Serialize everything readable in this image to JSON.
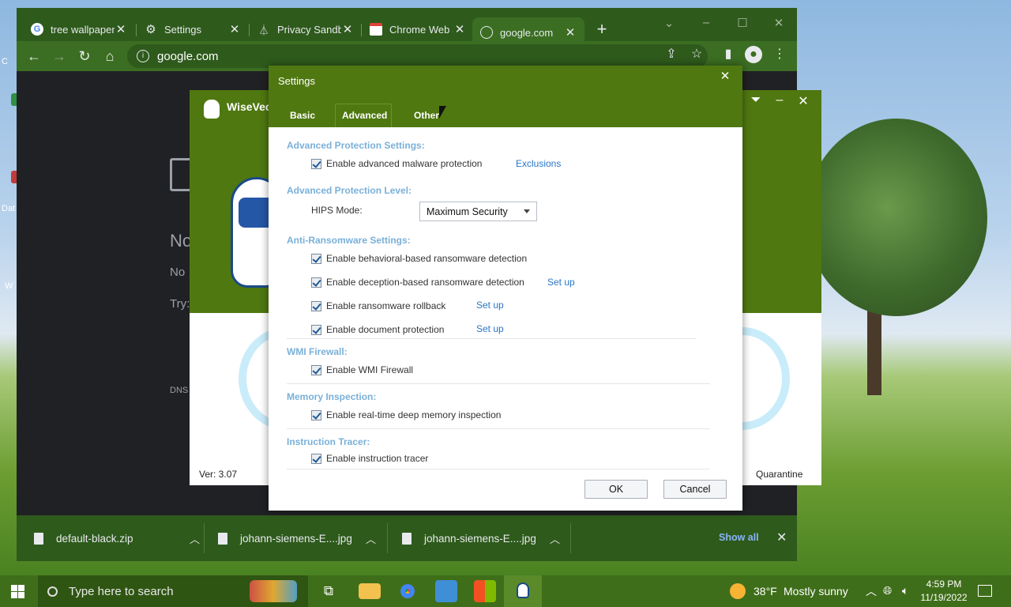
{
  "desktop": {
    "icon_labels": [
      "C",
      "C",
      "Dat",
      "W"
    ]
  },
  "chrome": {
    "tabs": [
      {
        "label": "tree wallpaper",
        "icon": "google-icon"
      },
      {
        "label": "Settings",
        "icon": "gear-icon"
      },
      {
        "label": "Privacy Sandbox",
        "icon": "flask-icon"
      },
      {
        "label": "Chrome Web Store",
        "icon": "store-icon"
      },
      {
        "label": "google.com",
        "icon": "globe-icon",
        "active": true
      }
    ],
    "url": "google.com",
    "page": {
      "heading": "No",
      "line1": "No",
      "try": "Try:",
      "dns": "DNS"
    },
    "downloads": [
      {
        "name": "default-black.zip"
      },
      {
        "name": "johann-siemens-E....jpg"
      },
      {
        "name": "johann-siemens-E....jpg"
      }
    ],
    "show_all": "Show all"
  },
  "wisevector": {
    "title": "WiseVec",
    "version": "Ver: 3.07",
    "quarantine": "Quarantine",
    "partial": "s"
  },
  "settings": {
    "title": "Settings",
    "tabs": [
      "Basic",
      "Advanced",
      "Other"
    ],
    "active_tab": "Advanced",
    "sections": {
      "adv_protection": {
        "title": "Advanced Protection Settings:",
        "malware": "Enable advanced malware protection",
        "exclusions": "Exclusions"
      },
      "level": {
        "title": "Advanced Protection Level:",
        "hips_label": "HIPS Mode:",
        "hips_value": "Maximum Security"
      },
      "ransomware": {
        "title": "Anti-Ransomware Settings:",
        "behavioral": "Enable behavioral-based ransomware detection",
        "deception": "Enable deception-based ransomware detection",
        "rollback": "Enable ransomware rollback",
        "document": "Enable document protection",
        "setup": "Set up"
      },
      "wmi": {
        "title": "WMI Firewall:",
        "enable": "Enable WMI Firewall"
      },
      "memory": {
        "title": "Memory Inspection:",
        "enable": "Enable real-time deep memory inspection"
      },
      "tracer": {
        "title": "Instruction Tracer:",
        "enable": "Enable instruction tracer"
      }
    },
    "ok": "OK",
    "cancel": "Cancel"
  },
  "taskbar": {
    "search_placeholder": "Type here to search",
    "weather_temp": "38°F",
    "weather_desc": "Mostly sunny",
    "time": "4:59 PM",
    "date": "11/19/2022"
  }
}
